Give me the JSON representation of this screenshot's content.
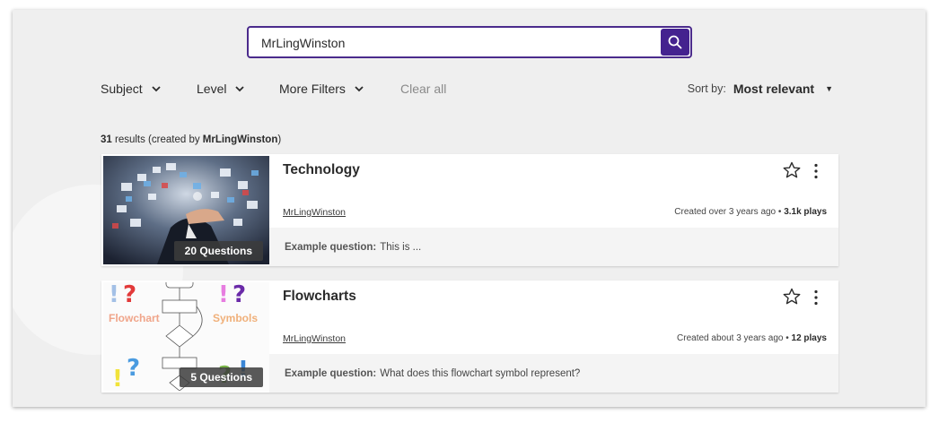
{
  "search": {
    "value": "MrLingWinston",
    "placeholder": ""
  },
  "filters": [
    {
      "label": "Subject"
    },
    {
      "label": "Level"
    },
    {
      "label": "More Filters"
    }
  ],
  "clear_all": "Clear all",
  "sort": {
    "label": "Sort by:",
    "value": "Most relevant"
  },
  "results": {
    "count": "31",
    "text_a": " results (created by ",
    "creator": "MrLingWinston",
    "text_b": ")"
  },
  "cards": [
    {
      "title": "Technology",
      "author": "MrLingWinston",
      "created": "Created over 3 years ago",
      "sep": " • ",
      "plays": "3.1k plays",
      "questions": "20 Questions",
      "example_label": "Example question:",
      "example_text": "This is ..."
    },
    {
      "title": "Flowcharts",
      "author": "MrLingWinston",
      "created": "Created about 3 years ago",
      "sep": " • ",
      "plays": "12 plays",
      "questions": "5 Questions",
      "example_label": "Example question:",
      "example_text": "What does this flowchart symbol represent?",
      "thumb_text": {
        "left": "Flowchart",
        "right": "Symbols"
      }
    }
  ],
  "colors": {
    "accent": "#44228f",
    "frame_bg": "#efefef"
  },
  "icons": {
    "search": "search-icon",
    "star": "star-icon",
    "more": "more-vertical-icon",
    "chevron": "chevron-down-icon"
  }
}
